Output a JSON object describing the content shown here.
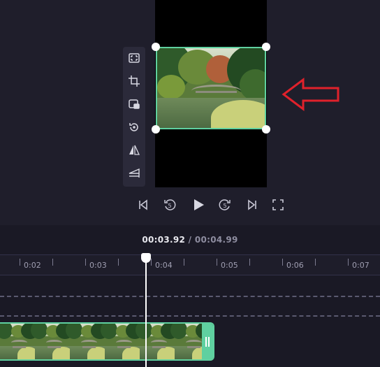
{
  "player": {
    "current_time": "00:03.92",
    "separator": " / ",
    "total_time": "00:04.99"
  },
  "toolbar": {
    "tools": [
      "fit-screen-icon",
      "crop-icon",
      "picture-in-picture-icon",
      "rotate-icon",
      "flip-horizontal-icon",
      "flip-vertical-icon"
    ]
  },
  "controls": [
    "skip-to-start-icon",
    "rewind-5s-icon",
    "play-icon",
    "forward-5s-icon",
    "skip-to-end-icon",
    "fullscreen-icon"
  ],
  "ruler": {
    "labels": [
      "0:02",
      "0:03",
      "0:04",
      "0:05",
      "0:06",
      "0:07"
    ]
  },
  "playhead": {
    "time": "00:03.92"
  },
  "colors": {
    "background": "#1f1e2b",
    "selection_accent": "#5fd0a0",
    "annotation_arrow": "#e0212b"
  }
}
